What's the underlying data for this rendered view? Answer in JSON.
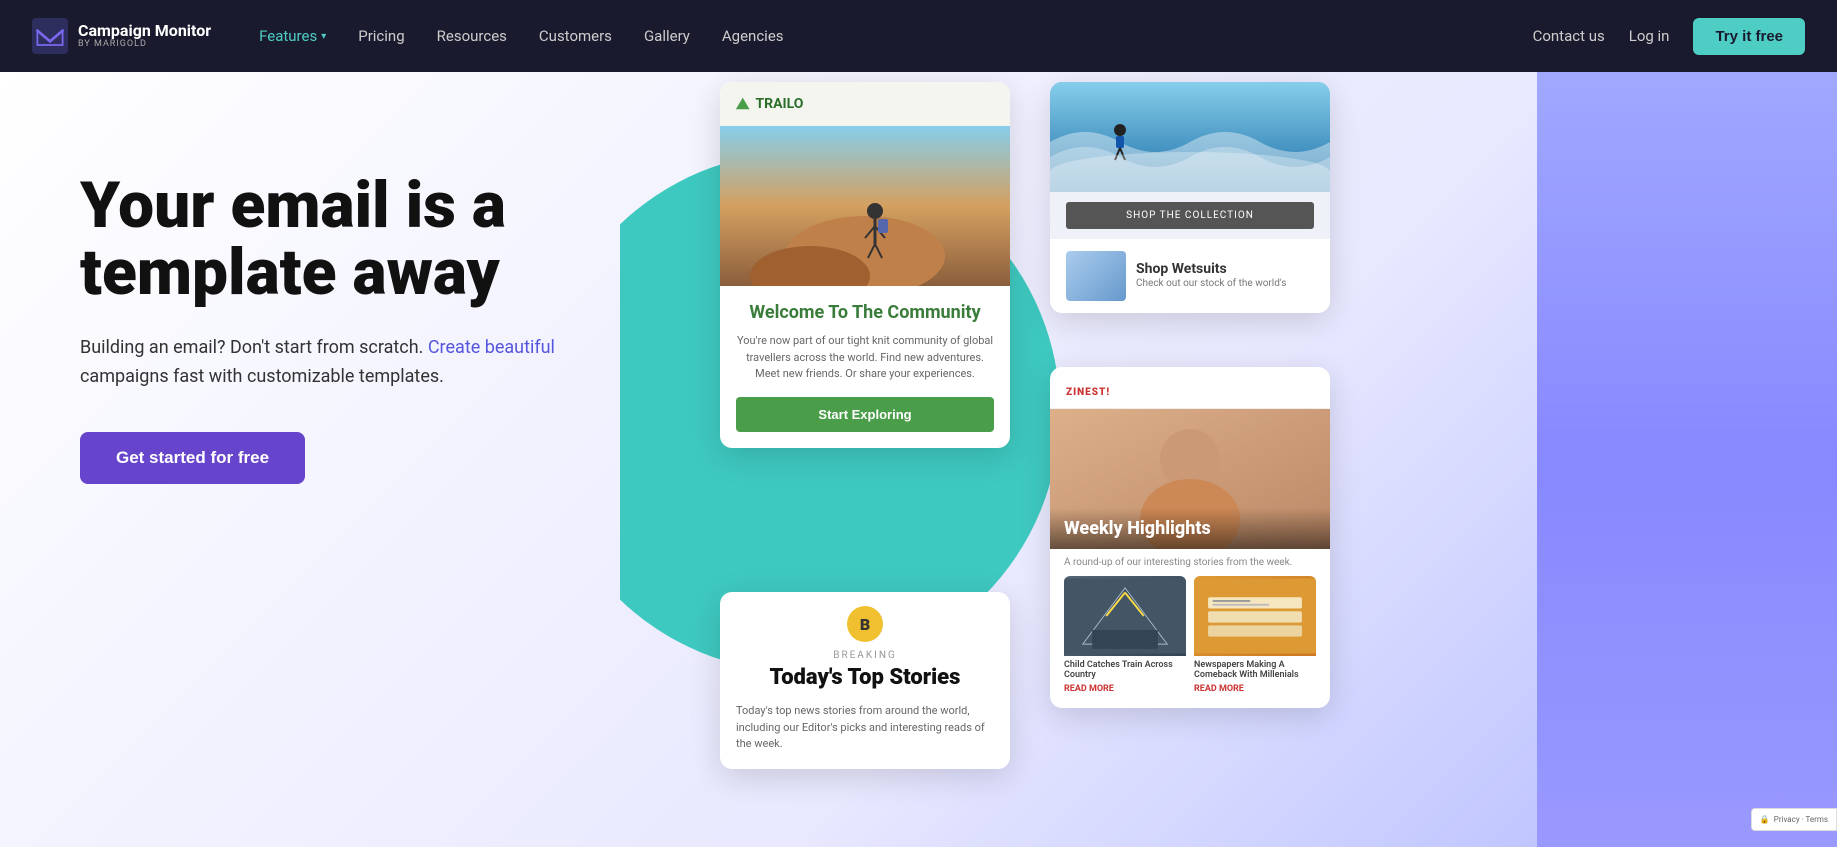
{
  "nav": {
    "logo_brand": "Campaign Monitor",
    "logo_sub": "by MARIGOLD",
    "features_label": "Features",
    "pricing_label": "Pricing",
    "resources_label": "Resources",
    "customers_label": "Customers",
    "gallery_label": "Gallery",
    "agencies_label": "Agencies",
    "contact_label": "Contact us",
    "login_label": "Log in",
    "cta_label": "Try it free"
  },
  "hero": {
    "title": "Your email is a template away",
    "subtitle_start": "Building an email? Don't start from scratch.",
    "subtitle_link": "Create beautiful",
    "subtitle_end": "campaigns fast with customizable templates.",
    "cta_label": "Get started for free"
  },
  "trailo_card": {
    "logo": "TRAILO",
    "heading": "Welcome To The Community",
    "body": "You're now part of our tight knit community of global travellers across the world. Find new adventures. Meet new friends. Or share your experiences.",
    "btn": "Start Exploring"
  },
  "news_card": {
    "badge": "B",
    "breaking": "BREAKING",
    "title": "Today's Top Stories",
    "body": "Today's top news stories from around the world, including our Editor's picks and interesting reads of the week."
  },
  "wetsuits_card": {
    "btn_label": "SHOP THE COLLECTION",
    "product_title": "Shop Wetsuits",
    "product_desc": "Check out our stock of the world's"
  },
  "zinest_card": {
    "logo": "ZINEST",
    "hero_label": "Weekly Highlights",
    "tagline": "A round-up of our interesting stories from the week.",
    "item1_caption": "Child Catches Train Across Country",
    "item1_read_more": "READ MORE",
    "item2_caption": "Newspapers Making A Comeback With Millenials",
    "item2_read_more": "READ MORE"
  },
  "recaptcha": {
    "label": "Privacy · Terms"
  }
}
